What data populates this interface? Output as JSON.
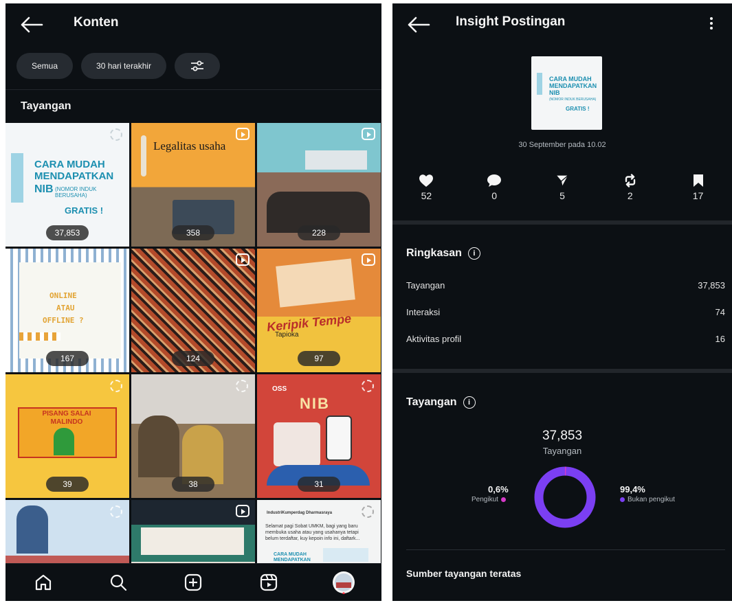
{
  "left": {
    "title": "Konten",
    "filters": {
      "all": "Semua",
      "range": "30 hari terakhir"
    },
    "section": "Tayangan",
    "tiles": [
      {
        "views": "37,853",
        "type": "carousel",
        "heading": "CARA MUDAH MENDAPATKAN",
        "sub": "NIB",
        "sub2": "(NOMOR INDUK BERUSAHA)",
        "cta": "GRATIS !"
      },
      {
        "views": "358",
        "type": "reel",
        "heading": "Legalitas usaha"
      },
      {
        "views": "228",
        "type": "reel"
      },
      {
        "views": "167",
        "type": "carousel",
        "heading": "ONLINE",
        "sub": "ATAU",
        "sub2": "OFFLINE ?"
      },
      {
        "views": "124",
        "type": "reel"
      },
      {
        "views": "97",
        "type": "reel",
        "heading": "Keripik Tempe",
        "sub": "Tapioka"
      },
      {
        "views": "39",
        "type": "carousel",
        "heading": "PISANG SALAI MALINDO"
      },
      {
        "views": "38",
        "type": "carousel"
      },
      {
        "views": "31",
        "type": "carousel",
        "heading": "NIB",
        "badge": "OSS"
      },
      {
        "views": "",
        "type": "carousel"
      },
      {
        "views": "",
        "type": "reel"
      },
      {
        "views": "",
        "type": "carousel",
        "heading": "IndustriKumperdag Dharmasraya",
        "body": "Selamat pagi Sobat UMKM, bagi yang baru membuka usaha atau yang usahanya tetapi belum terdaftar, kuy kepoin info ini, daftark...",
        "sub": "CARA MUDAH MENDAPATKAN NIB"
      }
    ],
    "nav": [
      "home-icon",
      "search-icon",
      "create-icon",
      "reels-icon",
      "profile-avatar"
    ]
  },
  "right": {
    "title": "Insight Postingan",
    "thumb": {
      "heading": "CARA MUDAH MENDAPATKAN NIB",
      "sub": "(NOMOR INDUK BERUSAHA)",
      "cta": "GRATIS !"
    },
    "date": "30 September pada 10.02",
    "metrics": [
      {
        "icon": "heart-icon",
        "value": "52"
      },
      {
        "icon": "comment-icon",
        "value": "0"
      },
      {
        "icon": "share-icon",
        "value": "5"
      },
      {
        "icon": "repost-icon",
        "value": "2"
      },
      {
        "icon": "save-icon",
        "value": "17"
      }
    ],
    "summary": {
      "heading": "Ringkasan",
      "rows": [
        {
          "label": "Tayangan",
          "value": "37,853"
        },
        {
          "label": "Interaksi",
          "value": "74"
        },
        {
          "label": "Aktivitas profil",
          "value": "16"
        }
      ]
    },
    "views": {
      "heading": "Tayangan",
      "total": "37,853",
      "total_label": "Tayangan",
      "followers_pct": "0,6%",
      "followers_label": "Pengikut",
      "nonfollowers_pct": "99,4%",
      "nonfollowers_label": "Bukan pengikut",
      "followers_fraction": 0.006,
      "colors": {
        "followers": "#d63ac8",
        "nonfollowers": "#7b3ff2"
      }
    },
    "top_sources": "Sumber tayangan teratas"
  }
}
